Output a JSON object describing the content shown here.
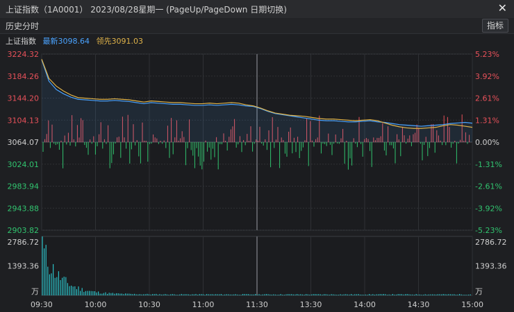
{
  "window": {
    "title": "上证指数（1A0001）  2023/08/28星期一    (PageUp/PageDown 日期切换)",
    "close_icon": "close-icon"
  },
  "toolbar": {
    "mode_label": "历史分时",
    "indicator_button": "指标"
  },
  "legend": {
    "index_name": "上证指数",
    "latest_label": "最新3098.64",
    "leading_label": "领先3091.03"
  },
  "colors": {
    "price_line": "#4aa3ff",
    "leading_line": "#e0b34a",
    "up": "#e8515a",
    "down": "#31c46f",
    "volume": "#2cc0c6"
  },
  "chart_data": {
    "type": "line",
    "title": "上证指数",
    "prev_close": 3064.07,
    "y_ticks_left": [
      "3224.32",
      "3184.26",
      "3144.20",
      "3104.13",
      "3064.07",
      "3024.01",
      "2983.94",
      "2943.88",
      "2903.82"
    ],
    "y_ticks_right": [
      "5.23%",
      "3.92%",
      "2.61%",
      "1.31%",
      "0.00%",
      "-1.31%",
      "-2.61%",
      "-3.92%",
      "-5.23%"
    ],
    "x_ticks": [
      "09:30",
      "10:00",
      "10:30",
      "11:00",
      "11:30",
      "13:30",
      "14:00",
      "14:30",
      "15:00"
    ],
    "ylim": [
      2903.82,
      3224.32
    ],
    "series": [
      {
        "name": "最新",
        "values": [
          3214,
          3175,
          3160,
          3152,
          3146,
          3142,
          3141,
          3140,
          3139,
          3139,
          3140,
          3139,
          3138,
          3136,
          3134,
          3136,
          3135,
          3134,
          3133,
          3133,
          3132,
          3131,
          3131,
          3132,
          3131,
          3132,
          3133,
          3132,
          3130,
          3129,
          3125,
          3120,
          3116,
          3114,
          3112,
          3110,
          3108,
          3106,
          3104,
          3103,
          3103,
          3102,
          3101,
          3101,
          3102,
          3103,
          3101,
          3100,
          3098,
          3096,
          3095,
          3094,
          3093,
          3094,
          3095,
          3096,
          3098,
          3099,
          3100,
          3098.64
        ]
      },
      {
        "name": "领先",
        "values": [
          3215,
          3180,
          3166,
          3157,
          3150,
          3145,
          3144,
          3143,
          3142,
          3142,
          3143,
          3142,
          3141,
          3139,
          3137,
          3139,
          3138,
          3137,
          3136,
          3136,
          3135,
          3134,
          3134,
          3135,
          3134,
          3135,
          3136,
          3135,
          3132,
          3130,
          3126,
          3121,
          3117,
          3115,
          3113,
          3112,
          3111,
          3109,
          3107,
          3106,
          3106,
          3105,
          3104,
          3103,
          3104,
          3105,
          3103,
          3099,
          3095,
          3092,
          3090,
          3089,
          3089,
          3090,
          3091,
          3094,
          3096,
          3095,
          3093,
          3091.03
        ]
      }
    ],
    "volume": {
      "unit": "万",
      "ticks": [
        "2786.72",
        "1393.36"
      ],
      "max": 2786.72
    }
  }
}
